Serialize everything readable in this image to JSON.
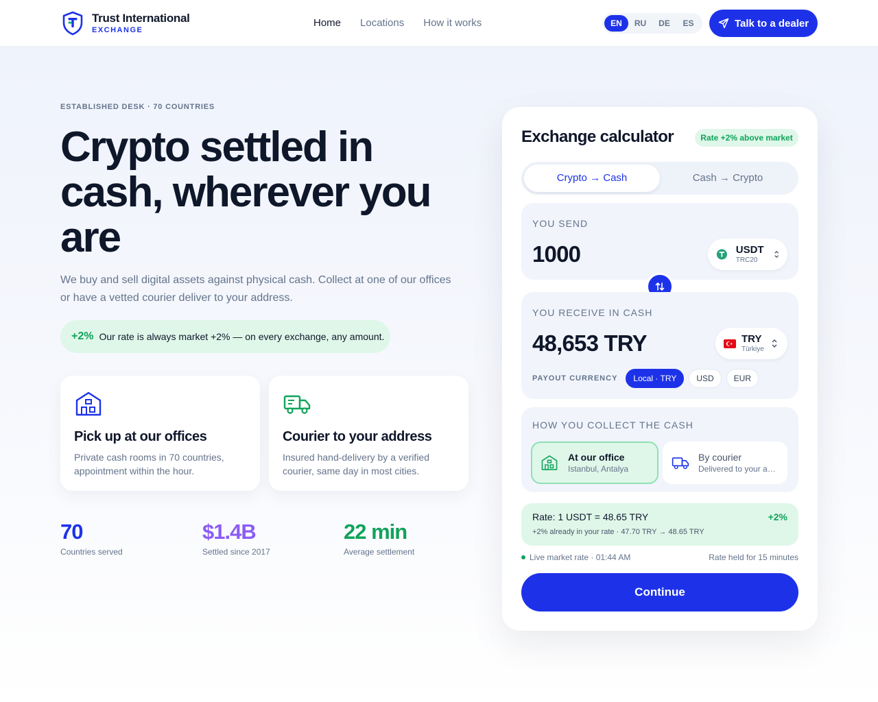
{
  "brand": {
    "name": "Trust International",
    "tagline": "EXCHANGE"
  },
  "nav": {
    "items": [
      "Home",
      "Locations",
      "How it works"
    ],
    "active": "Home"
  },
  "languages": {
    "items": [
      "EN",
      "RU",
      "DE",
      "ES"
    ],
    "active": "EN"
  },
  "header": {
    "cta_label": "Talk to a dealer"
  },
  "hero": {
    "eyebrow": "ESTABLISHED DESK · 70 COUNTRIES",
    "title": "Crypto settled in cash, wherever you are",
    "subtitle": "We buy and sell digital assets against physical cash. Collect at one of our offices or have a vetted courier deliver to your address.",
    "rate_pill": {
      "value": "+2%",
      "text": "Our rate is always market +2% — on every exchange, any amount."
    }
  },
  "features": [
    {
      "title": "Pick up at our offices",
      "desc": "Private cash rooms in 70 countries, appointment within the hour.",
      "icon": "office-icon"
    },
    {
      "title": "Courier to your address",
      "desc": "Insured hand-delivery by a verified courier, same day in most cities.",
      "icon": "truck-icon"
    }
  ],
  "stats": [
    {
      "value": "70",
      "label": "Countries served",
      "color": "#1d32e8"
    },
    {
      "value": "$1.4B",
      "label": "Settled since 2017",
      "color": "#8b5cf6"
    },
    {
      "value": "22 min",
      "label": "Average settlement",
      "color": "#10a35b"
    }
  ],
  "calculator": {
    "title": "Exchange calculator",
    "badge": "Rate +2% above market",
    "tabs": [
      "Crypto → Cash",
      "Cash → Crypto"
    ],
    "active_tab": "Crypto → Cash",
    "send": {
      "label": "YOU SEND",
      "amount": "1000",
      "currency": "USDT",
      "network": "TRC20"
    },
    "receive": {
      "label": "YOU RECEIVE IN CASH",
      "amount": "48,653 TRY",
      "currency": "TRY",
      "country": "Türkiye",
      "payout_label": "PAYOUT CURRENCY",
      "payout_options": [
        "Local · TRY",
        "USD",
        "EUR"
      ],
      "payout_active": "Local · TRY"
    },
    "collect": {
      "label": "HOW YOU COLLECT THE CASH",
      "options": [
        {
          "title": "At our office",
          "sub": "Istanbul, Antalya",
          "icon": "office-icon"
        },
        {
          "title": "By courier",
          "sub": "Delivered to your address",
          "icon": "truck-icon"
        }
      ],
      "active": "At our office"
    },
    "rate": {
      "line": "Rate: 1 USDT = 48.65 TRY",
      "detail": "+2% already in your rate · 47.70 TRY → 48.65 TRY",
      "badge": "+2%"
    },
    "live": "Live market rate · 01:44 AM",
    "held": "Rate held for 15 minutes",
    "continue": "Continue"
  },
  "colors": {
    "accent": "#1d32e8",
    "success": "#10a35b",
    "success_bg": "#dff7e9"
  }
}
